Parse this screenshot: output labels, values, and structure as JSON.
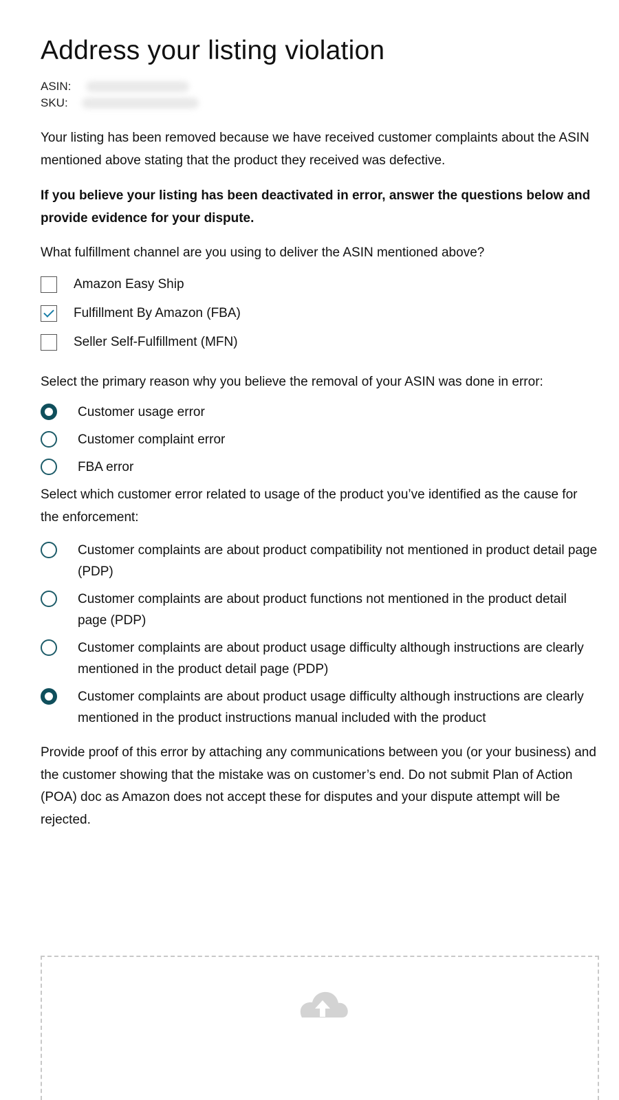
{
  "page": {
    "title": "Address your listing violation",
    "asin_label": "ASIN:",
    "sku_label": "SKU:",
    "intro": "Your listing has been removed because we have received customer complaints about the ASIN mentioned above stating that the product they received was defective.",
    "notice": "If you believe your listing has been deactivated in error, answer the questions below and provide evidence for your dispute."
  },
  "fulfillment": {
    "question": "What fulfillment channel are you using to deliver the ASIN mentioned above?",
    "options": [
      {
        "label": "Amazon Easy Ship",
        "checked": false
      },
      {
        "label": "Fulfillment By Amazon (FBA)",
        "checked": true
      },
      {
        "label": "Seller Self-Fulfillment (MFN)",
        "checked": false
      }
    ]
  },
  "reason": {
    "question": "Select the primary reason why you believe the removal of your ASIN was done in error:",
    "options": [
      {
        "label": "Customer usage error",
        "selected": true
      },
      {
        "label": "Customer complaint error",
        "selected": false
      },
      {
        "label": "FBA error",
        "selected": false
      }
    ]
  },
  "customer_error": {
    "question": "Select which customer error related to usage of the product you’ve identified as the cause for the enforcement:",
    "options": [
      {
        "label": "Customer complaints are about product compatibility not mentioned in product detail page (PDP)",
        "selected": false
      },
      {
        "label": "Customer complaints are about product functions not mentioned in the product detail page (PDP)",
        "selected": false
      },
      {
        "label": "Customer complaints are about product usage difficulty although instructions are clearly mentioned in the product detail page (PDP)",
        "selected": false
      },
      {
        "label": "Customer complaints are about product usage difficulty although instructions are clearly mentioned in the product instructions manual included with the product",
        "selected": true
      }
    ]
  },
  "proof": {
    "text": "Provide proof of this error by attaching any communications between you (or your business) and the customer showing that the mistake was on customer’s end. Do not submit Plan of Action (POA) doc as Amazon does not accept these for disputes and your dispute attempt will be rejected."
  },
  "upload": {
    "icon": "cloud-upload-icon",
    "icon_color": "#d3d3d3"
  },
  "colors": {
    "radio_selected": "#0f4f5c",
    "checkbox_check": "#1a7ea7",
    "text": "#111111"
  }
}
